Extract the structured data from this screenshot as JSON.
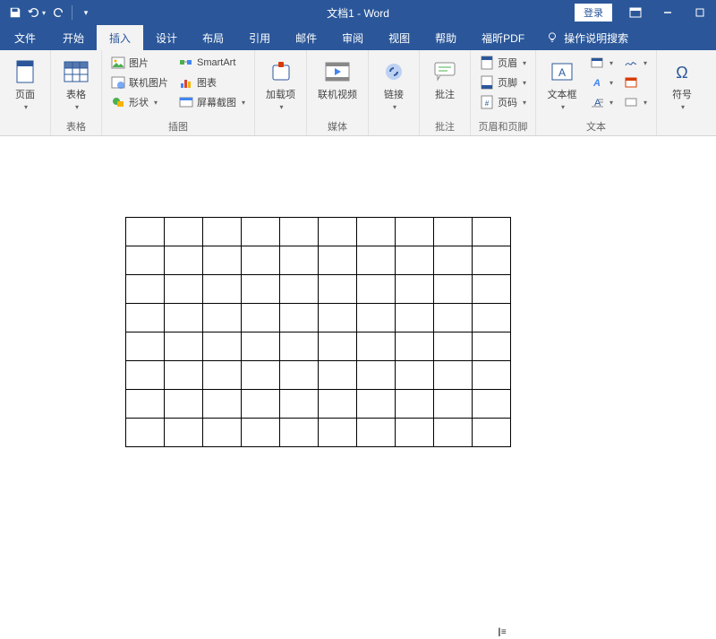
{
  "title": "文档1 - Word",
  "login": "登录",
  "tabs": {
    "file": "文件",
    "home": "开始",
    "insert": "插入",
    "design": "设计",
    "layout": "布局",
    "references": "引用",
    "mailings": "邮件",
    "review": "审阅",
    "view": "视图",
    "help": "帮助",
    "foxit": "福昕PDF"
  },
  "tell": "操作说明搜索",
  "ribbon": {
    "pages": {
      "cover": "页面",
      "group": "表格"
    },
    "tables": {
      "btn": "表格",
      "group": "表格"
    },
    "illus": {
      "pic": "图片",
      "online": "联机图片",
      "shapes": "形状",
      "smart": "SmartArt",
      "chart": "图表",
      "screen": "屏幕截图",
      "group": "插图"
    },
    "addins": {
      "btn": "加载项",
      "group": ""
    },
    "media": {
      "btn": "联机视频",
      "group": "媒体"
    },
    "links": {
      "btn": "链接",
      "group": ""
    },
    "comments": {
      "btn": "批注",
      "group": "批注"
    },
    "headerfooter": {
      "header": "页眉",
      "footer": "页脚",
      "pagenum": "页码",
      "group": "页眉和页脚"
    },
    "text": {
      "textbox": "文本框",
      "group": "文本"
    },
    "symbols": {
      "btn": "符号",
      "group": ""
    }
  },
  "table": {
    "rows": 8,
    "cols": 10
  }
}
